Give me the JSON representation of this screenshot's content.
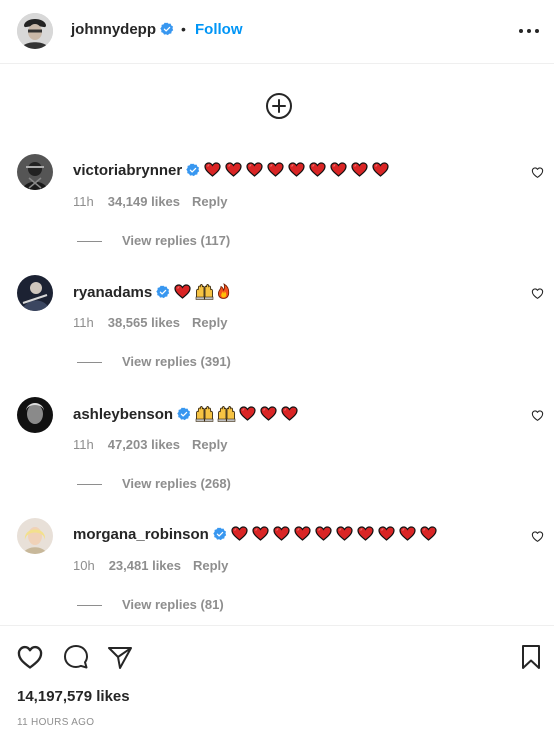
{
  "header": {
    "username": "johnnydepp",
    "separator": "•",
    "follow_label": "Follow",
    "verified": true
  },
  "load_more_icon": "plus-circle-icon",
  "comments": [
    {
      "username": "victoriabrynner",
      "verified": true,
      "text_emoji": [
        "red-heart",
        "red-heart",
        "red-heart",
        "red-heart",
        "red-heart",
        "red-heart",
        "red-heart",
        "red-heart",
        "red-heart"
      ],
      "time": "11h",
      "likes": "34,149 likes",
      "reply_label": "Reply",
      "view_replies": "View replies (117)"
    },
    {
      "username": "ryanadams",
      "verified": true,
      "text_emoji": [
        "red-heart",
        "raising-hands",
        "fire"
      ],
      "time": "11h",
      "likes": "38,565 likes",
      "reply_label": "Reply",
      "view_replies": "View replies (391)"
    },
    {
      "username": "ashleybenson",
      "verified": true,
      "text_emoji": [
        "raising-hands",
        "raising-hands",
        "red-heart",
        "red-heart",
        "red-heart"
      ],
      "time": "11h",
      "likes": "47,203 likes",
      "reply_label": "Reply",
      "view_replies": "View replies (268)"
    },
    {
      "username": "morgana_robinson",
      "verified": true,
      "text_emoji": [
        "red-heart",
        "red-heart",
        "red-heart",
        "red-heart",
        "red-heart",
        "red-heart",
        "red-heart",
        "red-heart",
        "red-heart",
        "red-heart"
      ],
      "time": "10h",
      "likes": "23,481 likes",
      "reply_label": "Reply",
      "view_replies": "View replies (81)"
    }
  ],
  "footer": {
    "likes_total": "14,197,579 likes",
    "time_ago": "11 HOURS AGO"
  },
  "colors": {
    "accent": "#0095f6",
    "text": "#262626",
    "muted": "#8e8e8e",
    "heart": "#e0245e"
  }
}
